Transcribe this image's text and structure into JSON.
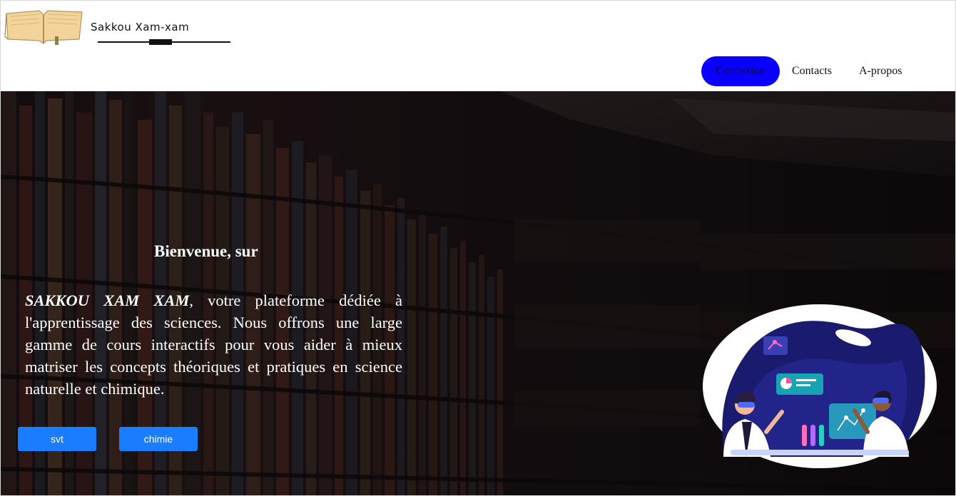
{
  "header": {
    "logo_text": "Sakkou Xam-xam",
    "nav": {
      "connexion": "Connexion",
      "contacts": "Contacts",
      "apropos": "A-propos"
    }
  },
  "hero": {
    "welcome": "Bienvenue, sur",
    "brand": "SAKKOU XAM XAM",
    "intro_rest": ", votre plateforme dédiée à l'apprentissage des sciences. Nous offrons une large gamme de cours interactifs pour vous aider à mieux matriser les concepts théoriques et pratiques en science naturelle et chimique.",
    "buttons": {
      "svt": "svt",
      "chimie": "chimie"
    }
  },
  "colors": {
    "connexion_bg": "#0a00ff",
    "button_bg": "#1a7dff",
    "hero_text": "#ffffff"
  },
  "icons": [
    "book-logo-icon",
    "science-lab-illustration"
  ]
}
